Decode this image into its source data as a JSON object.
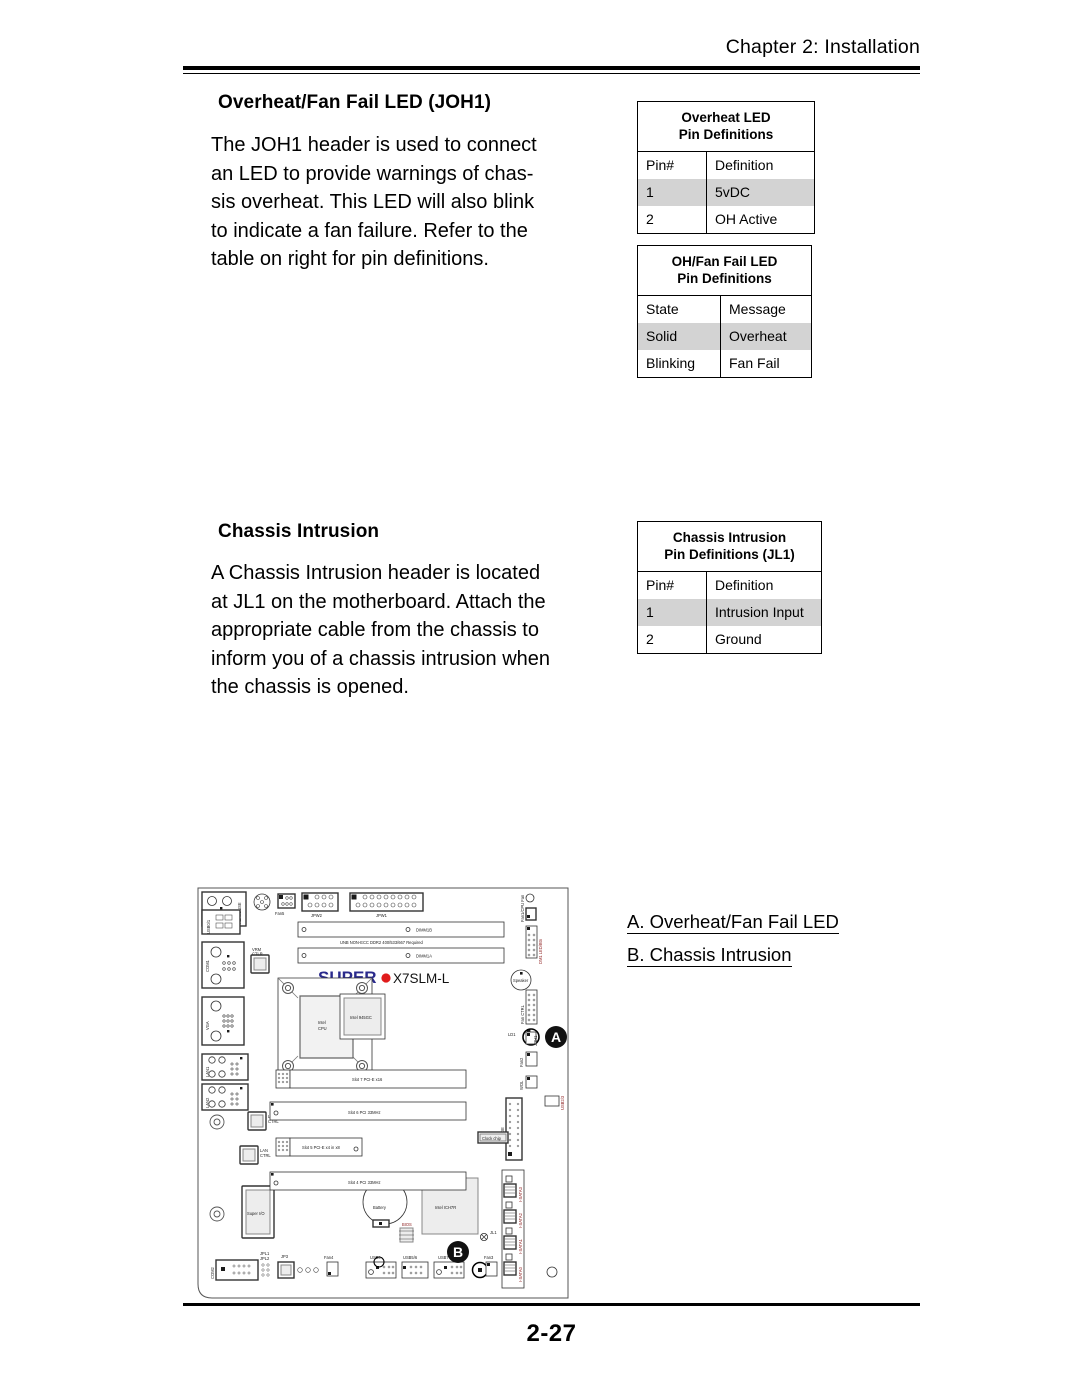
{
  "header": {
    "running_head": "Chapter 2: Installation"
  },
  "sections": [
    {
      "title": "Overheat/Fan Fail LED (JOH1)",
      "paragraph_lines": [
        "The JOH1 header is used to connect",
        "an LED to provide warnings of chas-",
        "sis overheat. This LED will also blink",
        "to indicate a fan failure. Refer to the",
        "table on right for pin definitions."
      ]
    },
    {
      "title": "Chassis Intrusion",
      "paragraph_lines": [
        "A Chassis Intrusion header is located",
        "at JL1 on the motherboard. Attach the",
        "appropriate cable from the chassis to",
        "inform you of a chassis intrusion when",
        "the chassis is opened."
      ]
    }
  ],
  "tables": [
    {
      "caption_line1": "Overheat LED",
      "caption_line2": "Pin Definitions",
      "headers": [
        "Pin#",
        "Definition"
      ],
      "rows": [
        {
          "cells": [
            "1",
            "5vDC"
          ],
          "shaded": true
        },
        {
          "cells": [
            "2",
            "OH Active"
          ],
          "shaded": false
        }
      ]
    },
    {
      "caption_line1": "OH/Fan Fail LED",
      "caption_line2": "Pin Definitions",
      "headers": [
        "State",
        "Message"
      ],
      "rows": [
        {
          "cells": [
            "Solid",
            "Overheat"
          ],
          "shaded": true
        },
        {
          "cells": [
            "Blinking",
            "Fan Fail"
          ],
          "shaded": false
        }
      ]
    },
    {
      "caption_line1": "Chassis Intrusion",
      "caption_line2": "Pin Definitions (JL1)",
      "headers": [
        "Pin#",
        "Definition"
      ],
      "rows": [
        {
          "cells": [
            "1",
            "Intrusion Input"
          ],
          "shaded": true
        },
        {
          "cells": [
            "2",
            "Ground"
          ],
          "shaded": false
        }
      ]
    }
  ],
  "legend": {
    "item_a": "A. Overheat/Fan Fail LED",
    "item_b": "B. Chassis Intrusion"
  },
  "footer": {
    "page_number": "2-27"
  },
  "board": {
    "brand": "SUPER",
    "model": "X7SLM-L",
    "callout_a": "A",
    "callout_b": "B",
    "memory_note": "UNB NON-ECC DDR2 400/533/667 Required",
    "labels": {
      "kb_mouse": "KB/MOUSE",
      "usb01": "USB0/1",
      "com1": "COM1",
      "vga": "VGA",
      "lan1": "LAN1",
      "lan2": "LAN2",
      "lan_ctrl1": "LAN CTRL",
      "lan_ctrl2": "LAN CTRL",
      "super_io": "Super I/O",
      "vrm_ctlr": "VRM CTLR",
      "fan5": "Fan5",
      "jpw2": "JPW2",
      "jpw1": "JPW1",
      "dimm1b": "DIMM1B",
      "dimm1a": "DIMM1A",
      "cpu": "Intel CPU",
      "northbridge": "Intel 945GC",
      "southbridge": "Intel ICH7R",
      "fan_cpu": "Fan1/CPU Fan",
      "speaker": "Speaker",
      "fan_ctrl": "Fan CTRL",
      "ld1": "LD1",
      "joh1": "JOH1",
      "fan2": "Fan2",
      "wol": "WOL",
      "clock_chip": "Clock chip",
      "ide": "IDE",
      "battery": "Battery",
      "bios": "BIOS",
      "jl1": "JL1",
      "fan3": "Fan3",
      "jpl1": "JPL1",
      "jpl2": "JPL2",
      "jp3": "JP3",
      "fan4": "Fan4",
      "com2": "COM2",
      "usb4": "USB4",
      "usb56": "USB5/6",
      "usb7": "USB7",
      "usb23": "USB2/3",
      "sata0": "I-SATA0",
      "sata1": "I-SATA1",
      "sata2": "I-SATA2",
      "sata3": "I-SATA3",
      "slot7": "Slot 7 PCI-E x16",
      "slot6": "Slot 6 PCI 33MHz",
      "slot5": "Slot 5 PCI-E x4 in x8",
      "slot4": "Slot 4 PCI 33MHz"
    }
  }
}
